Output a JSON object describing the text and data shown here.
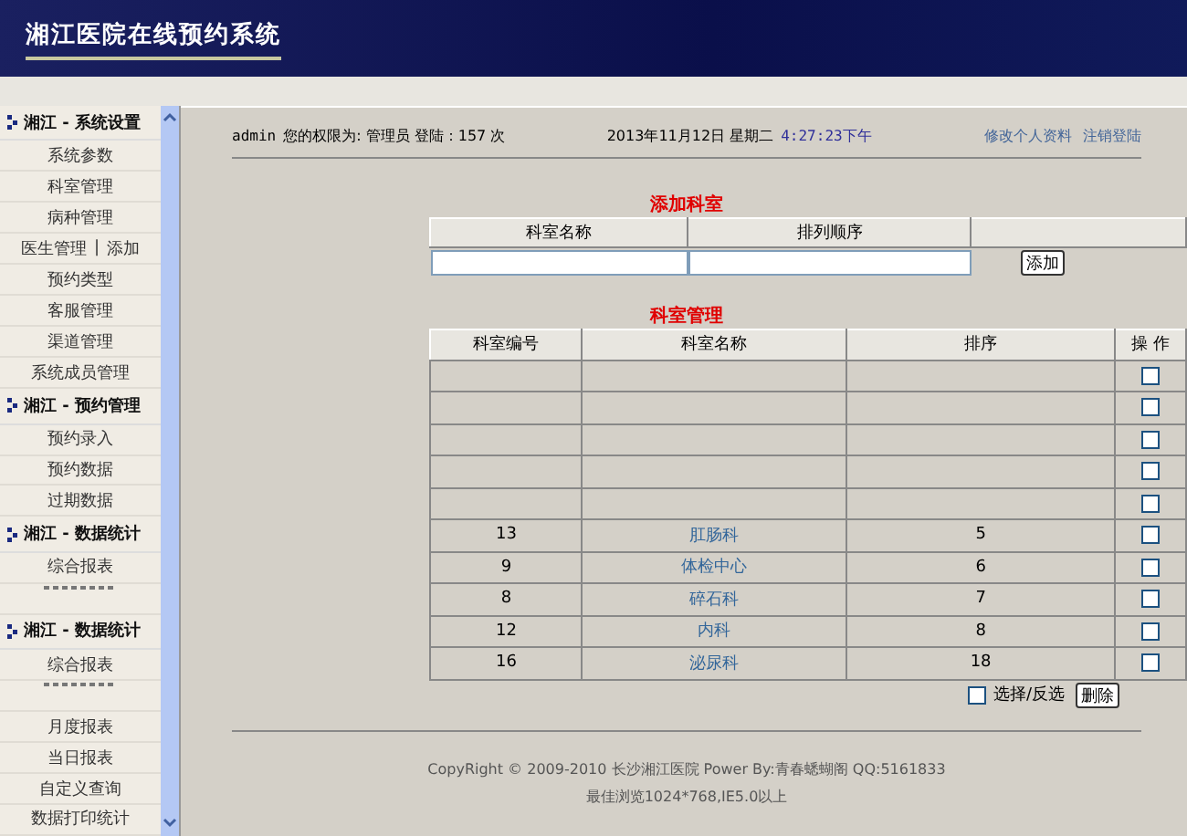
{
  "header": {
    "title": "湘江医院在线预约系统"
  },
  "sidebar": {
    "sections": [
      {
        "title": "湘江 - 系统设置",
        "items": [
          {
            "label": "系统参数"
          },
          {
            "label": "科室管理"
          },
          {
            "label": "病种管理"
          },
          {
            "label": "医生管理",
            "separator": "|",
            "link": "添加"
          },
          {
            "label": "预约类型"
          },
          {
            "label": "客服管理"
          },
          {
            "label": "渠道管理"
          },
          {
            "label": "系统成员管理"
          }
        ]
      },
      {
        "title": "湘江 - 预约管理",
        "items": [
          {
            "label": "预约录入"
          },
          {
            "label": "预约数据"
          },
          {
            "label": "过期数据"
          }
        ]
      },
      {
        "title": "湘江 - 数据统计",
        "items": [
          {
            "label": "综合报表"
          },
          {
            "kind": "blank"
          }
        ]
      },
      {
        "title": "湘江 - 数据统计",
        "items": [
          {
            "label": "综合报表"
          },
          {
            "kind": "blank"
          },
          {
            "label": "月度报表"
          },
          {
            "label": "当日报表"
          },
          {
            "label": "自定义查询"
          },
          {
            "label": "数据打印统计"
          }
        ]
      }
    ]
  },
  "topbar": {
    "user": "admin",
    "permission": "您的权限为: 管理员 登陆：157 次",
    "date": "2013年11月12日 星期二",
    "time": "4:27:23下午",
    "links": [
      "修改个人资料",
      "注销登陆"
    ]
  },
  "add_form": {
    "title": "添加科室",
    "columns": [
      "科室名称",
      "排列顺序"
    ],
    "button": "添加"
  },
  "table": {
    "title": "科室管理",
    "columns": [
      "科室编号",
      "科室名称",
      "排序",
      "操 作"
    ],
    "rows": [
      {
        "checked": false
      },
      {
        "checked": false
      },
      {
        "checked": false
      },
      {
        "checked": false
      },
      {
        "checked": false
      },
      {
        "id": "13",
        "name": "肛肠科",
        "order": "5",
        "checked": false
      },
      {
        "id": "9",
        "name": "体检中心",
        "order": "6",
        "checked": false
      },
      {
        "id": "8",
        "name": "碎石科",
        "order": "7",
        "checked": false
      },
      {
        "id": "12",
        "name": "内科",
        "order": "8",
        "checked": false
      },
      {
        "id": "16",
        "name": "泌尿科",
        "order": "18",
        "checked": false
      }
    ],
    "select_all": {
      "label": "选择/反选",
      "checked": false
    },
    "delete_button": "删除"
  },
  "footer": {
    "copyright": "CopyRight © 2009-2010 长沙湘江医院 Power By:青春蟋蝴阁 QQ:5161833",
    "note": "最佳浏览1024*768,IE5.0以上"
  }
}
